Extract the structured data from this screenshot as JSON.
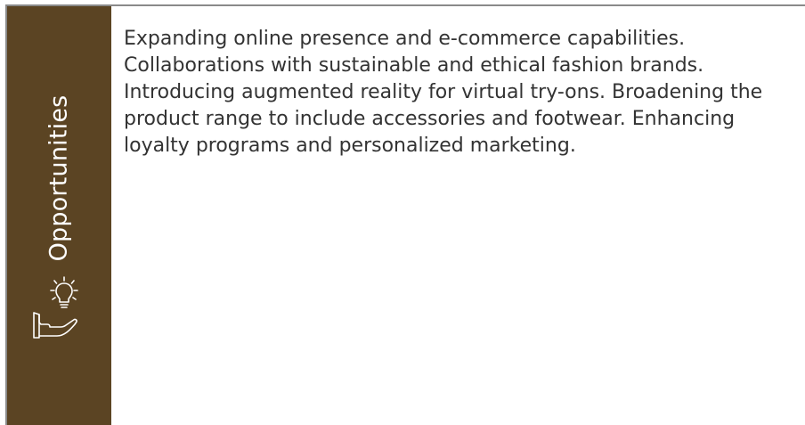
{
  "section": {
    "label": "Opportunities",
    "icon": "hand-lightbulb-icon",
    "accent_color": "#5b4423",
    "body_text": "Expanding online presence and e-commerce capabilities. Collaborations with sustainable and ethical fashion brands. Introducing augmented reality for virtual try-ons. Broadening the product range to include accessories and footwear. Enhancing loyalty programs and personalized marketing."
  }
}
